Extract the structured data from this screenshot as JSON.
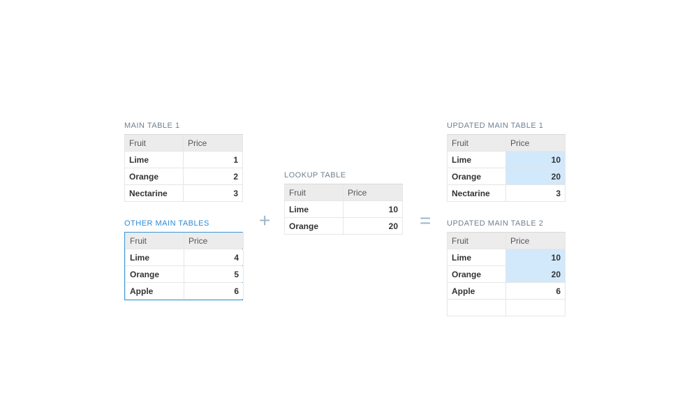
{
  "captions": {
    "main1": "MAIN TABLE 1",
    "other": "OTHER MAIN TABLES",
    "lookup": "LOOKUP TABLE",
    "updated1": "UPDATED MAIN TABLE 1",
    "updated2": "UPDATED MAIN TABLE 2"
  },
  "headers": {
    "fruit": "Fruit",
    "price": "Price"
  },
  "main1": {
    "rows": [
      {
        "fruit": "Lime",
        "price": "1"
      },
      {
        "fruit": "Orange",
        "price": "2"
      },
      {
        "fruit": "Nectarine",
        "price": "3"
      }
    ]
  },
  "other": {
    "rows": [
      {
        "fruit": "Lime",
        "price": "4"
      },
      {
        "fruit": "Orange",
        "price": "5"
      },
      {
        "fruit": "Apple",
        "price": "6"
      }
    ]
  },
  "lookup": {
    "rows": [
      {
        "fruit": "Lime",
        "price": "10"
      },
      {
        "fruit": "Orange",
        "price": "20"
      }
    ]
  },
  "updated1": {
    "rows": [
      {
        "fruit": "Lime",
        "price": "10",
        "updated": true
      },
      {
        "fruit": "Orange",
        "price": "20",
        "updated": true
      },
      {
        "fruit": "Nectarine",
        "price": "3",
        "updated": false
      }
    ]
  },
  "updated2": {
    "rows": [
      {
        "fruit": "Lime",
        "price": "10",
        "updated": true
      },
      {
        "fruit": "Orange",
        "price": "20",
        "updated": true
      },
      {
        "fruit": "Apple",
        "price": "6",
        "updated": false
      }
    ]
  },
  "ops": {
    "plus": "+",
    "equals": "="
  }
}
